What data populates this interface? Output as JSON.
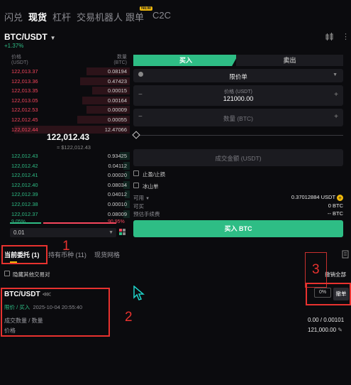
{
  "top_tabs": [
    "闪兑",
    "现货",
    "杠杆",
    "交易机器人",
    "跟单",
    "C2C"
  ],
  "top_tab_new_badge": "NEW",
  "pair": "BTC/USDT",
  "change": "+1.37%",
  "order_book": {
    "price_header": "价格",
    "price_unit": "(USDT)",
    "qty_header": "数量",
    "qty_unit": "(BTC)",
    "asks": [
      {
        "price": "122,013.37",
        "qty": "0.08194",
        "depth": 0.35
      },
      {
        "price": "122,013.36",
        "qty": "0.47423",
        "depth": 0.4
      },
      {
        "price": "122,013.35",
        "qty": "0.00015",
        "depth": 0.3
      },
      {
        "price": "122,013.05",
        "qty": "0.00164",
        "depth": 0.38
      },
      {
        "price": "122,012.53",
        "qty": "0.00009",
        "depth": 0.35
      },
      {
        "price": "122,012.45",
        "qty": "0.00055",
        "depth": 0.42
      },
      {
        "price": "122,012.44",
        "qty": "12.47066",
        "depth": 0.93
      }
    ],
    "last_price": "122,012.43",
    "last_price_fiat": "≈ $122,012.43",
    "bids": [
      {
        "price": "122,012.43",
        "qty": "0.93425",
        "depth": 0.08
      },
      {
        "price": "122,012.42",
        "qty": "0.04112",
        "depth": 0.05
      },
      {
        "price": "122,012.41",
        "qty": "0.00020",
        "depth": 0.04
      },
      {
        "price": "122,012.40",
        "qty": "0.08034",
        "depth": 0.05
      },
      {
        "price": "122,012.39",
        "qty": "0.04012",
        "depth": 0.04
      },
      {
        "price": "122,012.38",
        "qty": "0.00010",
        "depth": 0.04
      },
      {
        "price": "122,012.37",
        "qty": "0.08009",
        "depth": 0.05
      }
    ],
    "buy_ratio": "9.05%",
    "sell_ratio": "90.95%",
    "buy_ratio_value": 0.0905,
    "precision": "0.01"
  },
  "trade": {
    "buy_tab": "买入",
    "sell_tab": "卖出",
    "order_type": "限价单",
    "price_label": "价格 (USDT)",
    "price_value": "121000.00",
    "qty_placeholder": "数量 (BTC)",
    "amount_placeholder": "成交金额 (USDT)",
    "tp_sl_label": "止盈/止损",
    "iceberg_label": "冰山单",
    "available_label": "可用",
    "available_value": "0.37012884 USDT",
    "sellable_label": "可买",
    "sellable_value": "0 BTC",
    "fee_label": "预估手续费",
    "fee_value": "-- BTC",
    "buy_button": "买入 BTC",
    "minus": "−",
    "plus": "+"
  },
  "orders": {
    "tabs": [
      "当前委托 (1)",
      "持有币种 (11)",
      "现货网格"
    ],
    "hide_others": "隐藏其他交易对",
    "cancel_all": "撤销全部",
    "pair": "BTC/USDT",
    "type": "限价 / 买入",
    "time": "2025-10-04 20:55:40",
    "filled_label": "成交数量 / 数量",
    "filled_value": "0.00 / 0.00101",
    "price_label": "价格",
    "price_value": "121,000.00",
    "progress": "0%",
    "cancel": "撤单"
  },
  "annotations": [
    "1",
    "2",
    "3"
  ],
  "colors": {
    "buy": "#2ebd85",
    "sell": "#f6465d",
    "accent": "#f0b90b",
    "annotation": "#e8322f"
  }
}
